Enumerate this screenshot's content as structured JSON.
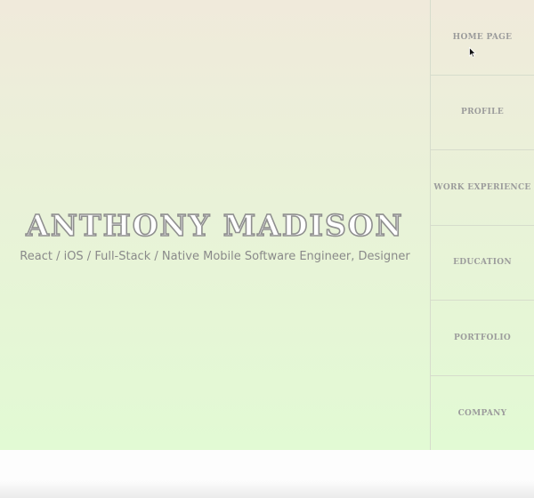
{
  "hero": {
    "name": "ANTHONY MADISON",
    "tagline": "React / iOS / Full-Stack / Native Mobile Software Engineer, Designer"
  },
  "nav": {
    "items": [
      {
        "label": "HOME PAGE"
      },
      {
        "label": "PROFILE"
      },
      {
        "label": "WORK EXPERIENCE"
      },
      {
        "label": "EDUCATION"
      },
      {
        "label": "PORTFOLIO"
      },
      {
        "label": "COMPANY"
      }
    ]
  },
  "colors": {
    "gradient_top": "#f0eadb",
    "gradient_bottom": "#e2fad4",
    "nav_text": "#9c9c9c",
    "name_outline": "#8f8f8f",
    "divider": "#d6dccc"
  },
  "icons": {
    "cursor": "mouse-pointer-icon"
  }
}
